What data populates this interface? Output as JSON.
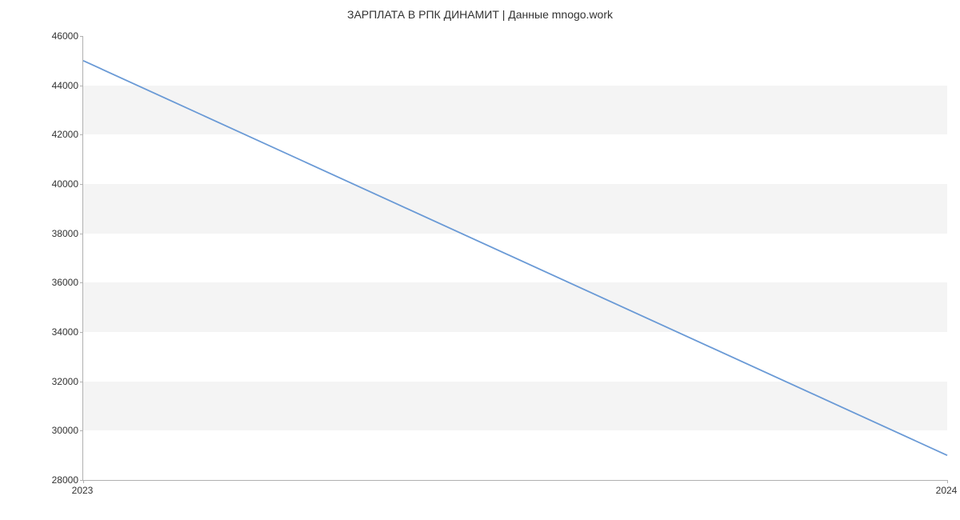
{
  "chart_data": {
    "type": "line",
    "title": "ЗАРПЛАТА В РПК ДИНАМИТ | Данные mnogo.work",
    "xlabel": "",
    "ylabel": "",
    "x": [
      2023,
      2024
    ],
    "y": [
      45000,
      29000
    ],
    "y_ticks": [
      28000,
      30000,
      32000,
      34000,
      36000,
      38000,
      40000,
      42000,
      44000,
      46000
    ],
    "x_ticks": [
      2023,
      2024
    ],
    "ylim": [
      28000,
      46000
    ],
    "xlim": [
      2023,
      2024
    ],
    "line_color": "#6a9ad6",
    "band_color": "#f4f4f4"
  }
}
